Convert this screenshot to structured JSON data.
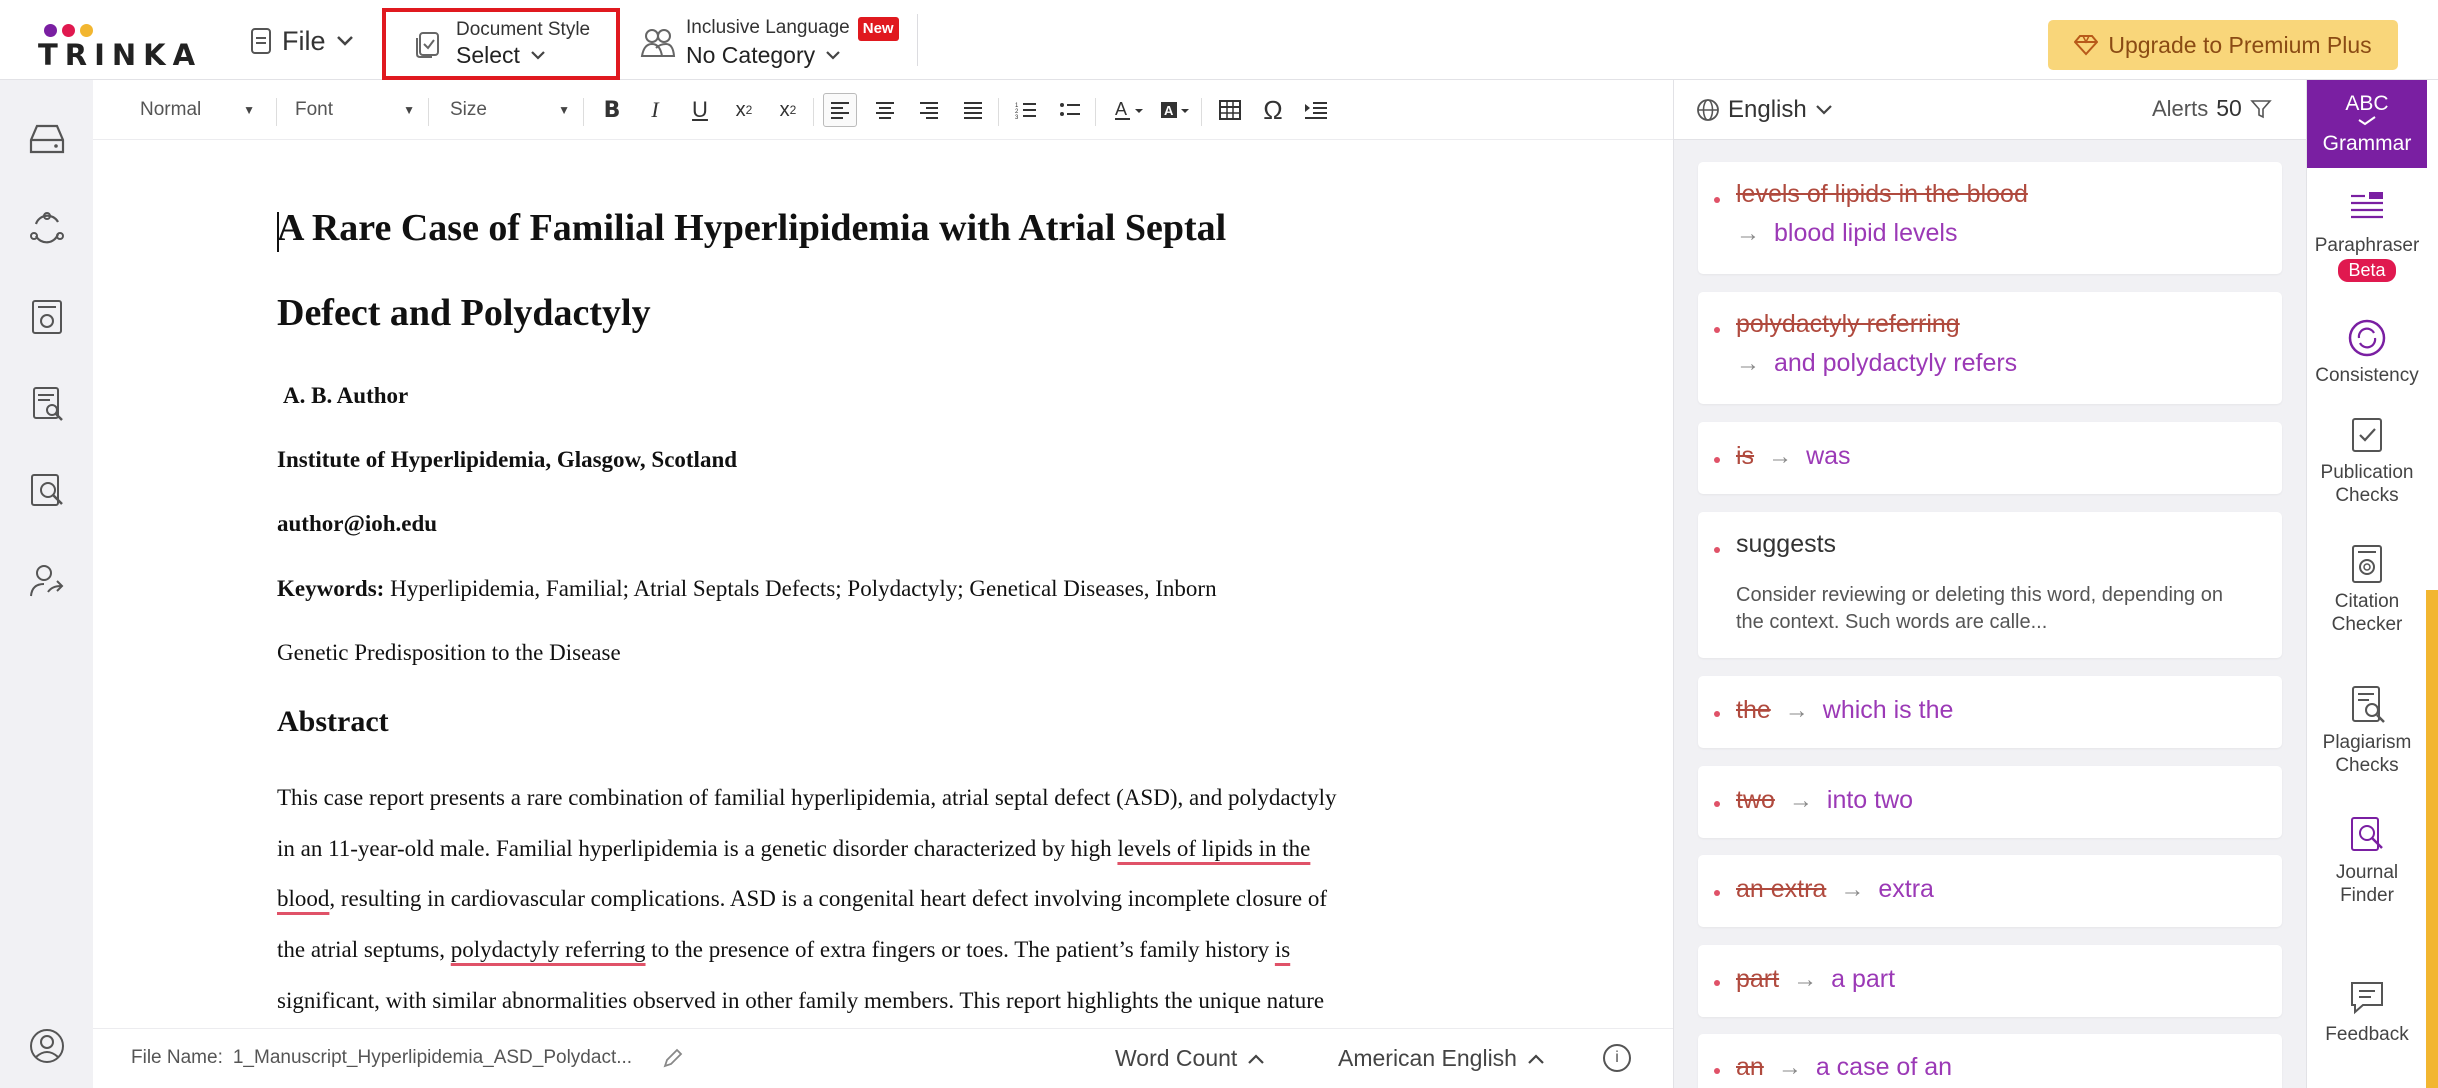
{
  "app": {
    "brand": "TRINKA",
    "brand_dot_colors": [
      "#7a1fa2",
      "#e0194f",
      "#f2b630"
    ],
    "accent_color": "#7a1fa2",
    "highlight_box_color": "#e0191f"
  },
  "topbar": {
    "file_label": "File",
    "doc_style_label": "Document Style",
    "doc_style_value": "Select",
    "inclusive_label": "Inclusive Language",
    "inclusive_badge": "New",
    "inclusive_value": "No Category",
    "upgrade_label": "Upgrade to Premium Plus"
  },
  "toolbar": {
    "style_select": "Normal",
    "font_select": "Font",
    "size_select": "Size",
    "buttons": [
      "bold",
      "italic",
      "underline",
      "subscript",
      "superscript",
      "align-left",
      "align-center",
      "align-right",
      "justify",
      "ordered-list",
      "bullet-list",
      "text-color",
      "highlight",
      "table",
      "special-character",
      "indent"
    ]
  },
  "document": {
    "title_line1": "A Rare Case of Familial Hyperlipidemia with Atrial Septal",
    "title_line2": "Defect and Polydactyly",
    "author": "A. B. Author",
    "institute": "Institute of Hyperlipidemia, Glasgow, Scotland",
    "email": "author@ioh.edu",
    "keywords_label": "Keywords:",
    "keywords_line1": " Hyperlipidemia, Familial; Atrial Septals Defects; Polydactyly; Genetical Diseases, Inborn",
    "keywords_line2": "Genetic Predisposition to the Disease",
    "abstract_heading": "Abstract",
    "body": {
      "l1": "This case report presents a rare combination of familial hyperlipidemia, atrial septal defect (ASD), and polydactyly",
      "l2a": "in an 11-year-old male. Familial hyperlipidemia is a genetic disorder characterized by high ",
      "l2b": "levels of lipids in the",
      "l3a": "blood",
      "l3b": ", resulting in cardiovascular complications. ASD is a congenital heart defect involving incomplete closure of",
      "l4a": "the atrial septums, ",
      "l4b": "polydactyly referring",
      "l4c": " to the presence of extra fingers or toes. The patient’s family history ",
      "l4d": "is",
      "l5": "significant, with similar abnormalities observed in other family members. This report highlights the unique nature"
    }
  },
  "statusbar": {
    "file_name_label": "File Name:",
    "file_name_value": "1_Manuscript_Hyperlipidemia_ASD_Polydact...",
    "word_count_label": "Word Count",
    "language_label": "American English"
  },
  "panel": {
    "language": "English",
    "alerts_label": "Alerts",
    "alerts_count": "50",
    "cards": [
      {
        "original": "levels of lipids in the blood",
        "suggestion": "blood lipid levels"
      },
      {
        "original": "polydactyly referring",
        "suggestion": "and polydactyly refers"
      },
      {
        "original": "is",
        "suggestion": "was"
      },
      {
        "word": "suggests",
        "description": "Consider reviewing or deleting this word, depending on the context. Such words are calle..."
      },
      {
        "original": "the",
        "suggestion": "which is the"
      },
      {
        "original": "two",
        "suggestion": "into two"
      },
      {
        "original": "an extra",
        "suggestion": "extra"
      },
      {
        "original": "part",
        "suggestion": "a part"
      },
      {
        "original": "an",
        "suggestion": "a case of an"
      }
    ]
  },
  "tools": {
    "grammar_icon_text": "ABC",
    "grammar": "Grammar",
    "paraphraser": "Paraphraser",
    "paraphraser_badge": "Beta",
    "consistency": "Consistency",
    "publication_l1": "Publication",
    "publication_l2": "Checks",
    "citation_l1": "Citation",
    "citation_l2": "Checker",
    "plagiarism_l1": "Plagiarism",
    "plagiarism_l2": "Checks",
    "journal_l1": "Journal",
    "journal_l2": "Finder",
    "feedback": "Feedback"
  }
}
